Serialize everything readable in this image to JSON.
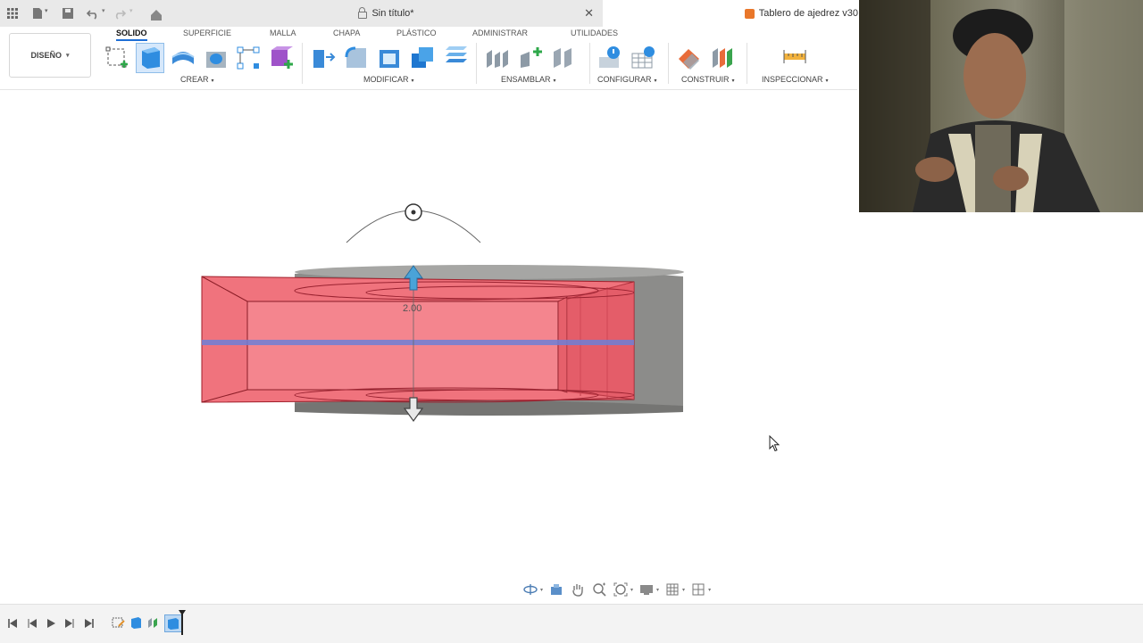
{
  "window": {
    "tab_inactive_title": "Sin título*",
    "tab_active_title": "Tablero de ajedrez v30",
    "tab_close_glyph": "✕"
  },
  "titlebar_icons": [
    "grid-icon",
    "file-icon",
    "save-icon",
    "undo-icon",
    "redo-icon",
    "home-icon"
  ],
  "workspace": {
    "label": "DISEÑO",
    "caret": "▾"
  },
  "tabs": [
    {
      "label": "SOLIDO",
      "active": true
    },
    {
      "label": "SUPERFICIE",
      "active": false
    },
    {
      "label": "MALLA",
      "active": false
    },
    {
      "label": "CHAPA",
      "active": false
    },
    {
      "label": "PLÁSTICO",
      "active": false
    },
    {
      "label": "ADMINISTRAR",
      "active": false
    },
    {
      "label": "UTILIDADES",
      "active": false
    }
  ],
  "groups": [
    {
      "label": "CREAR",
      "caret": "▾"
    },
    {
      "label": "MODIFICAR",
      "caret": "▾"
    },
    {
      "label": "ENSAMBLAR",
      "caret": "▾"
    },
    {
      "label": "CONFIGURAR",
      "caret": "▾"
    },
    {
      "label": "CONSTRUIR",
      "caret": "▾"
    },
    {
      "label": "INSPECCIONAR",
      "caret": "▾"
    }
  ],
  "viewport": {
    "dimension_value": "2.00"
  },
  "colors": {
    "accent": "#1e6fd6",
    "body_fill": "#f0737d",
    "body_stroke": "#a01e2a",
    "gray_body": "#8c8c8a",
    "arrow_blue": "#4aa3d8"
  },
  "navbar_icons": [
    "orbit-icon",
    "look-at-icon",
    "pan-icon",
    "zoom-icon",
    "fit-icon",
    "display-settings-icon",
    "grid-settings-icon",
    "viewports-icon"
  ],
  "timeline_icons": [
    "first-icon",
    "previous-icon",
    "play-icon",
    "next-icon",
    "last-icon"
  ],
  "timeline_features": [
    "sketch-feature-icon",
    "extrude-feature-icon",
    "sketch-feature-icon-2",
    "extrude-feature-icon-2"
  ]
}
